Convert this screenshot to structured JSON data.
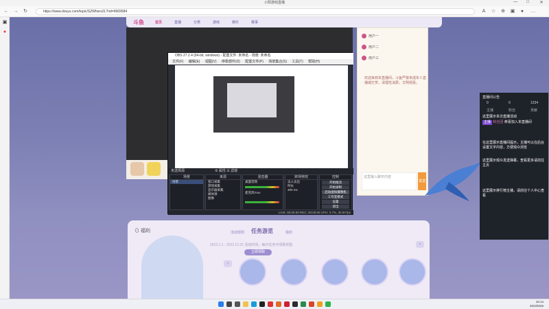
{
  "window": {
    "title": "小阳游戏直播",
    "minimize": "—",
    "maximize": "□",
    "close": "✕"
  },
  "browser": {
    "url": "https://www.douyu.com/topic/SZWhero2L?rid=9669584",
    "nav_icons": [
      "back-icon",
      "forward-icon",
      "refresh-icon",
      "home-icon"
    ],
    "toolbar_icons": [
      "read-aloud-icon",
      "favorites-icon",
      "extensions-icon",
      "collections-icon",
      "profile-icon",
      "more-icon"
    ]
  },
  "site": {
    "logo": "斗鱼",
    "nav": [
      "首页",
      "直播",
      "分类",
      "游戏",
      "娱乐",
      "赛事"
    ],
    "active_nav": 0,
    "chat": {
      "users": [
        "用户一",
        "用户二",
        "用户三"
      ],
      "message": "欢迎来到本直播间，斗鱼严禁未成年人直播或打赏，请理性消费，文明观看。",
      "input_placeholder": "这里输入聊天内容",
      "send": "发送"
    },
    "activity": {
      "icon": "⊙",
      "icon_label": "福利",
      "title": "任务游览",
      "link_left": "活动规则",
      "link_right": "我的",
      "subtitle": "2022.1.1 - 2022.12.31 活动时间，每日任务可领取奖励",
      "button": "立即领取",
      "side_left": "‹",
      "side_right": "›"
    }
  },
  "dark_panel": {
    "title": "直播间公告",
    "stats": [
      "0",
      "0",
      "1234"
    ],
    "tabs": [
      "主播",
      "粉丝",
      "贡献"
    ],
    "line1": "这里展示本次直播活动",
    "tag1": "主播",
    "tag2": "粉丝团",
    "line2": "恭喜加入本直播间",
    "block1": "在这里展示直播间提示，主播可以在后台设置文字内容，方便观众浏览",
    "block2": "这里展示观众发送弹幕，查看更多请前往主页",
    "block3": "这里展示排行榜主播，请前往个人中心查看"
  },
  "obs": {
    "title": "OBS 27.2.4 (64-bit, windows) - 配置文件: 未命名 - 场景: 未命名",
    "menu": [
      "文件(F)",
      "编辑(E)",
      "视图(V)",
      "停靠部件(D)",
      "配置文件(P)",
      "场景集合(S)",
      "工具(T)",
      "帮助(H)"
    ],
    "scene_bar": "未选择源",
    "scene_bar_right": "⚙ 属性   ☰ 滤镜",
    "docks": {
      "scenes": {
        "title": "场景",
        "items": [
          "场景"
        ]
      },
      "sources": {
        "title": "来源",
        "items": [
          "窗口采集",
          "游戏采集",
          "显示器采集",
          "媒体源",
          "图像"
        ]
      },
      "mixer": {
        "title": "混音器",
        "tracks": [
          "桌面音频",
          "麦克风/Aux"
        ]
      },
      "transitions": {
        "title": "转场特效",
        "items": [
          "淡入淡出",
          "时长",
          "300 ms"
        ]
      },
      "controls": {
        "title": "控制",
        "buttons": [
          "开始推流",
          "开始录制",
          "启动虚拟摄像机",
          "工作室模式",
          "设置",
          "退出"
        ]
      }
    },
    "status": "LIVE: 00:00:00   REC: 00:00:00   CPU: 3.7%, 30.00 fps"
  },
  "taskbar": {
    "time": "16:14",
    "date": "2022/5/26",
    "icons": [
      {
        "name": "start-icon",
        "color": "#2b7de9"
      },
      {
        "name": "search-icon",
        "color": "#444"
      },
      {
        "name": "taskview-icon",
        "color": "#555"
      },
      {
        "name": "explorer-icon",
        "color": "#f2c14e"
      },
      {
        "name": "edge-icon",
        "color": "#1d9bd6"
      },
      {
        "name": "obs-icon",
        "color": "#222"
      },
      {
        "name": "app1-icon",
        "color": "#d33"
      },
      {
        "name": "app2-icon",
        "color": "#e06b2d"
      },
      {
        "name": "app3-icon",
        "color": "#c23"
      },
      {
        "name": "app4-icon",
        "color": "#2b2b2b"
      },
      {
        "name": "app5-icon",
        "color": "#2a8a4a"
      },
      {
        "name": "app6-icon",
        "color": "#d8462a"
      },
      {
        "name": "app7-icon",
        "color": "#f0a020"
      },
      {
        "name": "app8-icon",
        "color": "#2fb24a"
      }
    ]
  }
}
